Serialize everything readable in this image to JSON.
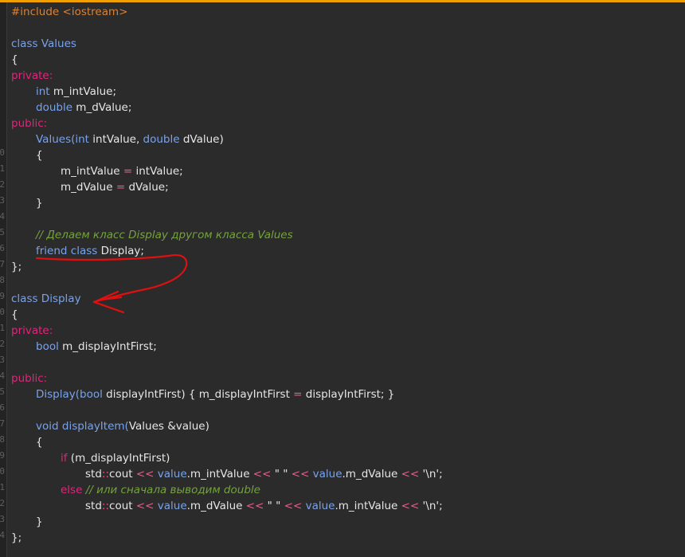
{
  "editor": {
    "line_numbers": [
      "",
      "",
      "",
      "",
      "",
      "",
      "",
      "",
      "",
      "0",
      "1",
      "2",
      "3",
      "4",
      "5",
      "6",
      "7",
      "8",
      "9",
      "0",
      "1",
      "2",
      "3",
      "4",
      "5",
      "6",
      "7",
      "8",
      "9",
      "0",
      "1",
      "2",
      "3",
      "4"
    ],
    "lines": [
      {
        "indent": 0,
        "tokens": [
          {
            "t": "#include <iostream>",
            "c": "pp"
          }
        ]
      },
      {
        "indent": 0,
        "tokens": []
      },
      {
        "indent": 0,
        "tokens": [
          {
            "t": "class Values",
            "c": "kw"
          }
        ]
      },
      {
        "indent": 0,
        "tokens": [
          {
            "t": "{",
            "c": ""
          }
        ]
      },
      {
        "indent": 0,
        "tokens": [
          {
            "t": "private:",
            "c": "acc"
          }
        ]
      },
      {
        "indent": 1,
        "tokens": [
          {
            "t": "int",
            "c": "kw"
          },
          {
            "t": " m_intValue;",
            "c": ""
          }
        ]
      },
      {
        "indent": 1,
        "tokens": [
          {
            "t": "double",
            "c": "kw"
          },
          {
            "t": " m_dValue;",
            "c": ""
          }
        ]
      },
      {
        "indent": 0,
        "tokens": [
          {
            "t": "public:",
            "c": "acc"
          }
        ]
      },
      {
        "indent": 1,
        "tokens": [
          {
            "t": "Values(",
            "c": "fn"
          },
          {
            "t": "int",
            "c": "kw"
          },
          {
            "t": " intValue, ",
            "c": ""
          },
          {
            "t": "double",
            "c": "kw"
          },
          {
            "t": " dValue)",
            "c": ""
          }
        ]
      },
      {
        "indent": 1,
        "tokens": [
          {
            "t": "{",
            "c": ""
          }
        ]
      },
      {
        "indent": 2,
        "tokens": [
          {
            "t": "m_intValue ",
            "c": ""
          },
          {
            "t": "=",
            "c": "op"
          },
          {
            "t": " intValue;",
            "c": ""
          }
        ]
      },
      {
        "indent": 2,
        "tokens": [
          {
            "t": "m_dValue ",
            "c": ""
          },
          {
            "t": "=",
            "c": "op"
          },
          {
            "t": " dValue;",
            "c": ""
          }
        ]
      },
      {
        "indent": 1,
        "tokens": [
          {
            "t": "}",
            "c": ""
          }
        ]
      },
      {
        "indent": 0,
        "tokens": []
      },
      {
        "indent": 1,
        "tokens": [
          {
            "t": "// Делаем класс Display другом класса Values",
            "c": "cm"
          }
        ]
      },
      {
        "indent": 1,
        "tokens": [
          {
            "t": "friend class",
            "c": "kw"
          },
          {
            "t": " Display;",
            "c": ""
          }
        ]
      },
      {
        "indent": 0,
        "tokens": [
          {
            "t": "};",
            "c": ""
          }
        ]
      },
      {
        "indent": 0,
        "tokens": []
      },
      {
        "indent": 0,
        "tokens": [
          {
            "t": "class Display",
            "c": "kw"
          }
        ]
      },
      {
        "indent": 0,
        "tokens": [
          {
            "t": "{",
            "c": ""
          }
        ]
      },
      {
        "indent": 0,
        "tokens": [
          {
            "t": "private:",
            "c": "acc"
          }
        ]
      },
      {
        "indent": 1,
        "tokens": [
          {
            "t": "bool",
            "c": "kw"
          },
          {
            "t": " m_displayIntFirst;",
            "c": ""
          }
        ]
      },
      {
        "indent": 0,
        "tokens": []
      },
      {
        "indent": 0,
        "tokens": [
          {
            "t": "public:",
            "c": "acc"
          }
        ]
      },
      {
        "indent": 1,
        "tokens": [
          {
            "t": "Display(",
            "c": "fn"
          },
          {
            "t": "bool",
            "c": "kw"
          },
          {
            "t": " displayIntFirst) { m_displayIntFirst ",
            "c": ""
          },
          {
            "t": "=",
            "c": "op"
          },
          {
            "t": " displayIntFirst; }",
            "c": ""
          }
        ]
      },
      {
        "indent": 0,
        "tokens": []
      },
      {
        "indent": 1,
        "tokens": [
          {
            "t": "void",
            "c": "kw"
          },
          {
            "t": " displayItem(",
            "c": "fn"
          },
          {
            "t": "Values &value)",
            "c": ""
          }
        ]
      },
      {
        "indent": 1,
        "tokens": [
          {
            "t": "{",
            "c": ""
          }
        ]
      },
      {
        "indent": 2,
        "tokens": [
          {
            "t": "if",
            "c": "acc"
          },
          {
            "t": " (m_displayIntFirst)",
            "c": ""
          }
        ]
      },
      {
        "indent": 3,
        "tokens": [
          {
            "t": "std",
            "c": ""
          },
          {
            "t": "::",
            "c": "op"
          },
          {
            "t": "cout ",
            "c": ""
          },
          {
            "t": "<<",
            "c": "op"
          },
          {
            "t": " ",
            "c": ""
          },
          {
            "t": "value",
            "c": "kw"
          },
          {
            "t": ".m_intValue ",
            "c": ""
          },
          {
            "t": "<<",
            "c": "op"
          },
          {
            "t": " \" \" ",
            "c": "st"
          },
          {
            "t": "<<",
            "c": "op"
          },
          {
            "t": " ",
            "c": ""
          },
          {
            "t": "value",
            "c": "kw"
          },
          {
            "t": ".m_dValue ",
            "c": ""
          },
          {
            "t": "<<",
            "c": "op"
          },
          {
            "t": " '\\n';",
            "c": ""
          }
        ]
      },
      {
        "indent": 2,
        "tokens": [
          {
            "t": "else",
            "c": "acc"
          },
          {
            "t": " // или сначала выводим double",
            "c": "cm"
          }
        ]
      },
      {
        "indent": 3,
        "tokens": [
          {
            "t": "std",
            "c": ""
          },
          {
            "t": "::",
            "c": "op"
          },
          {
            "t": "cout ",
            "c": ""
          },
          {
            "t": "<<",
            "c": "op"
          },
          {
            "t": " ",
            "c": ""
          },
          {
            "t": "value",
            "c": "kw"
          },
          {
            "t": ".m_dValue ",
            "c": ""
          },
          {
            "t": "<<",
            "c": "op"
          },
          {
            "t": " \" \" ",
            "c": "st"
          },
          {
            "t": "<<",
            "c": "op"
          },
          {
            "t": " ",
            "c": ""
          },
          {
            "t": "value",
            "c": "kw"
          },
          {
            "t": ".m_intValue ",
            "c": ""
          },
          {
            "t": "<<",
            "c": "op"
          },
          {
            "t": " '\\n';",
            "c": ""
          }
        ]
      },
      {
        "indent": 1,
        "tokens": [
          {
            "t": "}",
            "c": ""
          }
        ]
      },
      {
        "indent": 0,
        "tokens": [
          {
            "t": "};",
            "c": ""
          }
        ]
      }
    ]
  },
  "colors": {
    "background": "#2b2b2b",
    "keyword": "#7aa2e8",
    "access_specifier": "#e0267a",
    "preprocessor": "#d98234",
    "operator": "#f05a92",
    "comment": "#74a23e",
    "annotation": "#e01010"
  },
  "annotation": {
    "type": "hand-drawn arrow",
    "from": "friend class Display;",
    "to": "class Display"
  }
}
